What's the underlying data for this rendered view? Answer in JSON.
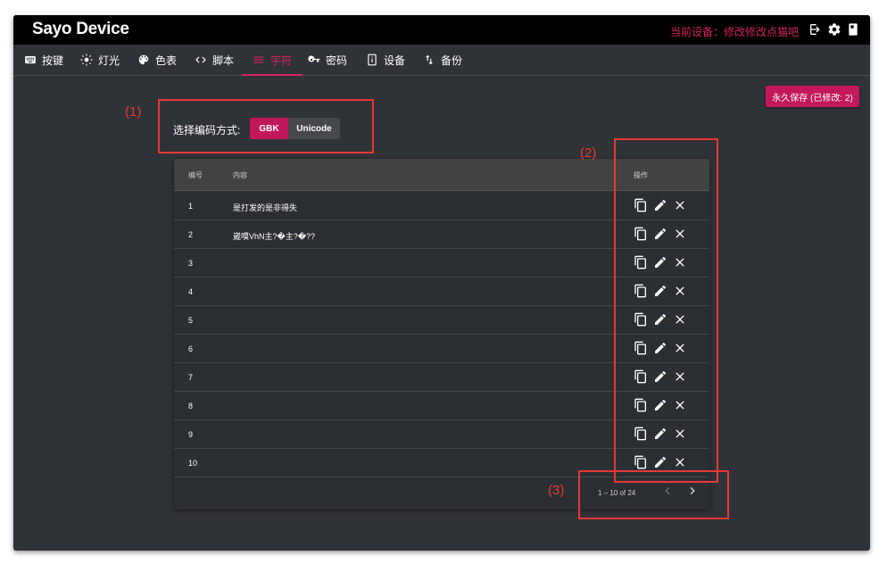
{
  "app": {
    "title": "Sayo Device",
    "device_label": "当前设备：修改修改点猫吧"
  },
  "titlebar_icons": [
    "login-icon",
    "gear-icon",
    "device-icon"
  ],
  "tabs": [
    {
      "label": "按键",
      "icon": "keyboard-icon",
      "active": false
    },
    {
      "label": "灯光",
      "icon": "brightness-icon",
      "active": false
    },
    {
      "label": "色表",
      "icon": "palette-icon",
      "active": false
    },
    {
      "label": "脚本",
      "icon": "code-icon",
      "active": false
    },
    {
      "label": "字符",
      "icon": "menu-lines-icon",
      "active": true
    },
    {
      "label": "密码",
      "icon": "key-icon",
      "active": false
    },
    {
      "label": "设备",
      "icon": "device-info-icon",
      "active": false
    },
    {
      "label": "备份",
      "icon": "swap-vertical-icon",
      "active": false
    }
  ],
  "save_button": "永久保存 (已修改: 2)",
  "encoding": {
    "label": "选择编码方式:",
    "options": [
      "GBK",
      "Unicode"
    ],
    "selected": "GBK"
  },
  "table": {
    "headers": {
      "num": "编号",
      "content": "内容",
      "actions": "操作"
    },
    "rows": [
      {
        "num": "1",
        "content": "是打发的是非得失"
      },
      {
        "num": "2",
        "content": "崴嗼VhN主?�主?�??"
      },
      {
        "num": "3",
        "content": ""
      },
      {
        "num": "4",
        "content": ""
      },
      {
        "num": "5",
        "content": ""
      },
      {
        "num": "6",
        "content": ""
      },
      {
        "num": "7",
        "content": ""
      },
      {
        "num": "8",
        "content": ""
      },
      {
        "num": "9",
        "content": ""
      },
      {
        "num": "10",
        "content": ""
      }
    ],
    "row_action_icons": [
      "copy-icon",
      "edit-icon",
      "delete-icon"
    ],
    "pagination": {
      "text": "1 – 10 of 24"
    }
  },
  "annotations": [
    "(1)",
    "(2)",
    "(3)"
  ],
  "colors": {
    "accent": "#c2185b",
    "accent_text": "#d6245e",
    "annotation": "#e53935",
    "background": "#2f3237",
    "titlebar": "#000000"
  }
}
